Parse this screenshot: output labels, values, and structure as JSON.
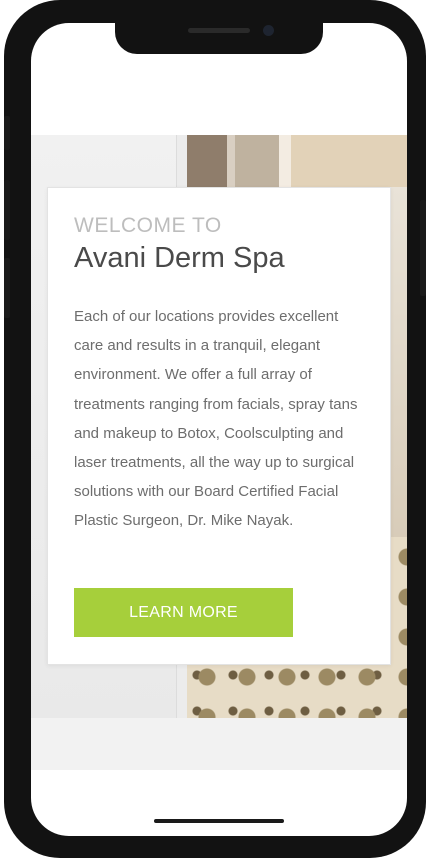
{
  "welcome": {
    "eyebrow": "WELCOME TO",
    "title": "Avani Derm Spa",
    "body": "Each of our locations provides excellent care and results in a tranquil, elegant environment. We offer a full array of treatments ranging from facials, spray tans and makeup to Botox, Coolsculpting and laser treatments, all the way up to surgical solutions with our Board Certified Facial Plastic Surgeon, Dr. Mike Nayak.",
    "button_label": "LEARN MORE"
  },
  "colors": {
    "accent": "#a6cf3b",
    "title": "#4a4a4a",
    "eyebrow": "#bdbdbd",
    "body": "#6d6d6d"
  }
}
